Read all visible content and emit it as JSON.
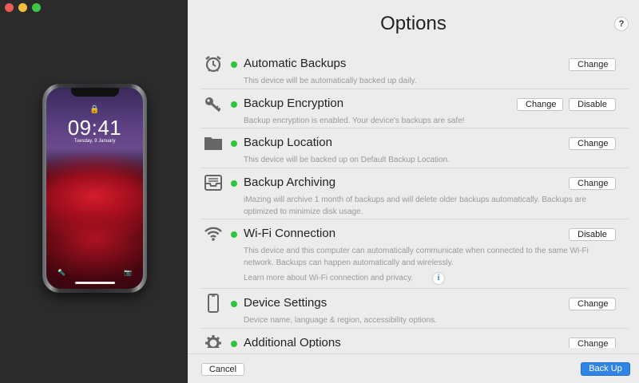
{
  "window": {
    "controls": [
      "close",
      "minimize",
      "zoom"
    ]
  },
  "device": {
    "time": "09:41",
    "date": "Tuesday, 9 January",
    "lock_glyph": "🔒",
    "torch_glyph": "🔦",
    "camera_glyph": "📷"
  },
  "header": {
    "title": "Options",
    "help": "?"
  },
  "rows": [
    {
      "icon": "alarm-clock-icon",
      "title": "Automatic Backups",
      "desc": "This device will be automatically backed up daily.",
      "buttons": [
        "Change"
      ]
    },
    {
      "icon": "key-icon",
      "title": "Backup Encryption",
      "desc": "Backup encryption is enabled. Your device's backups are safe!",
      "buttons": [
        "Change",
        "Disable"
      ]
    },
    {
      "icon": "folder-icon",
      "title": "Backup Location",
      "desc": "This device will be backed up on Default Backup Location.",
      "buttons": [
        "Change"
      ]
    },
    {
      "icon": "archive-tray-icon",
      "title": "Backup Archiving",
      "desc": "iMazing will archive 1 month of backups and will delete older backups automatically. Backups are optimized to minimize disk usage.",
      "buttons": [
        "Change"
      ]
    },
    {
      "icon": "wifi-icon",
      "title": "Wi-Fi Connection",
      "desc": "This device and this computer can automatically communicate when connected to the same Wi-Fi network. Backups can happen automatically and wirelessly.",
      "link": "Learn more about Wi-Fi connection and privacy.",
      "buttons": [
        "Disable"
      ]
    },
    {
      "icon": "phone-icon",
      "title": "Device Settings",
      "desc": "Device name, language & region, accessibility options.",
      "buttons": [
        "Change"
      ]
    },
    {
      "icon": "gear-icon",
      "title": "Additional Options",
      "desc": "",
      "buttons": [
        "Change"
      ]
    }
  ],
  "footer": {
    "cancel": "Cancel",
    "back_up": "Back Up"
  },
  "colors": {
    "accent": "#2f84e6",
    "status_green": "#2cc53a",
    "sidebar": "#2b2b2b"
  }
}
